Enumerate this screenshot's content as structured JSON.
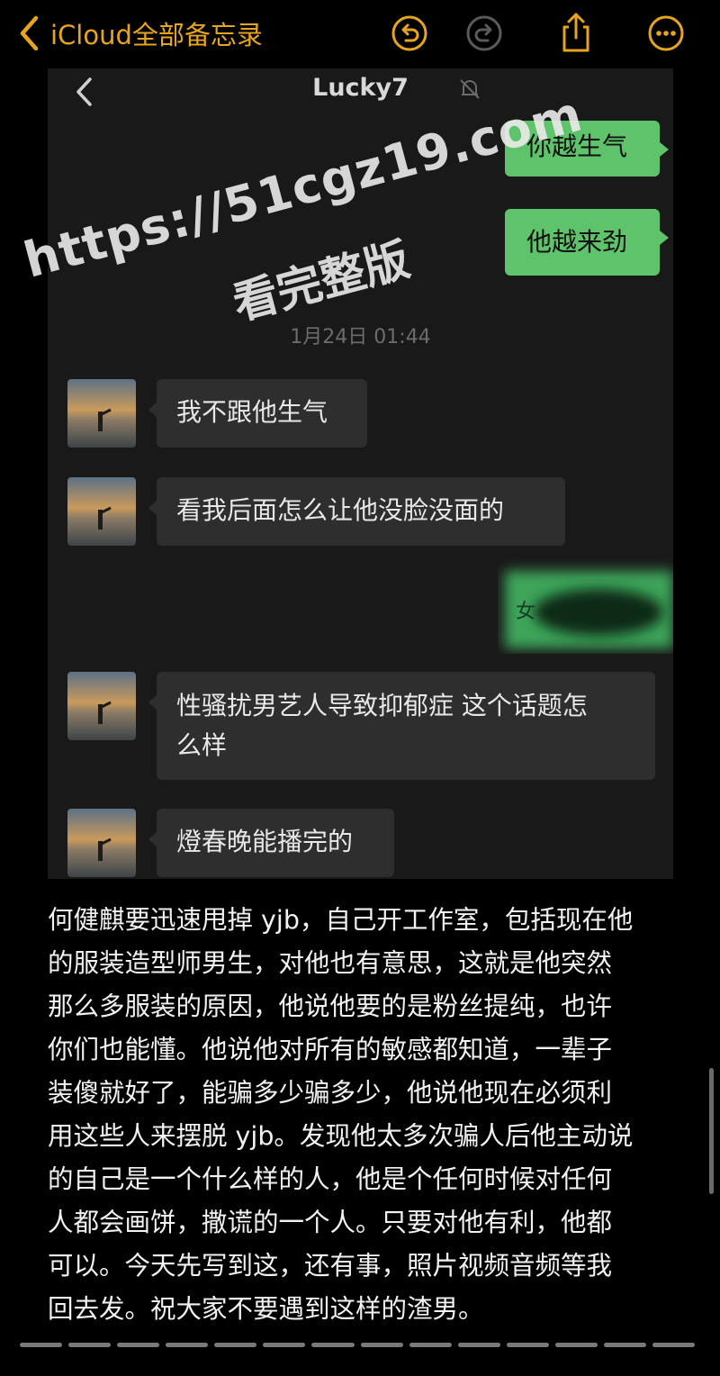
{
  "notes_bar": {
    "back_label": "iCloud全部备忘录",
    "accent": "#e6a51a"
  },
  "chat": {
    "title": "Lucky7",
    "timestamp": "1月24日 01:44",
    "outgoing": [
      "你越生气",
      "他越来劲"
    ],
    "incoming": [
      "我不跟他生气",
      "看我后面怎么让他没脸没面的",
      "性骚扰男艺人导致抑郁症 这个话题怎么样",
      "燈春晚能播完的"
    ],
    "incoming_3_lines": [
      "性骚扰男艺人导致抑郁症 这个话题怎",
      "么样"
    ],
    "blurred_prefix": "女"
  },
  "watermark": {
    "line1": "https://51cgz19.com",
    "line2": "看完整版"
  },
  "note": {
    "lines": [
      "何健麒要迅速甩掉 yjb，自己开工作室，包括现在他",
      "的服装造型师男生，对他也有意思，这就是他突然",
      "那么多服装的原因，他说他要的是粉丝提纯，也许",
      "你们也能懂。他说他对所有的敏感都知道，一辈子",
      "装傻就好了，能骗多少骗多少，他说他现在必须利",
      "用这些人来摆脱 yjb。发现他太多次骗人后他主动说",
      "的自己是一个什么样的人，他是个任何时候对任何",
      "人都会画饼，撒谎的一个人。只要对他有利，他都",
      "可以。今天先写到这，还有事，照片视频音频等我",
      "回去发。祝大家不要遇到这样的渣男。"
    ]
  },
  "colors": {
    "bubble_out": "#5ec36b",
    "bubble_in": "#2e2e2e",
    "chat_bg": "#191919"
  }
}
